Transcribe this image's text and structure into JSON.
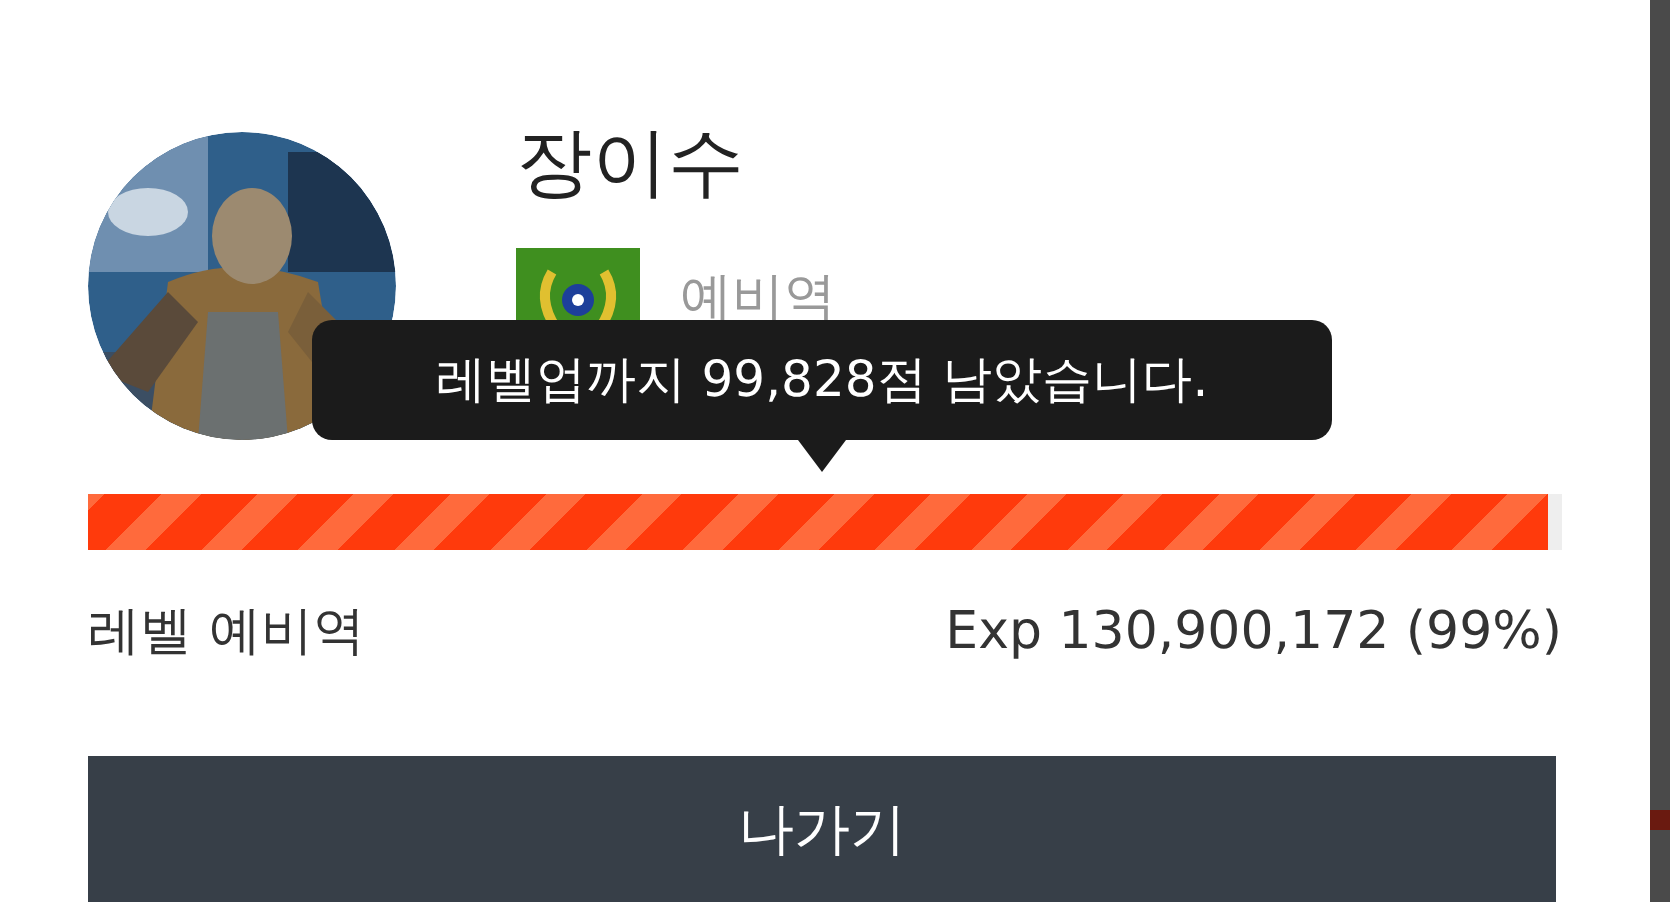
{
  "profile": {
    "name": "장이수",
    "rank_label": "예비역"
  },
  "tooltip": "레벨업까지 99,828점 남았습니다.",
  "progress": {
    "level": 0.99
  },
  "level_label": "레벨 예비역",
  "exp_label": "Exp 130,900,172 (99%)",
  "exit_button": "나가기"
}
